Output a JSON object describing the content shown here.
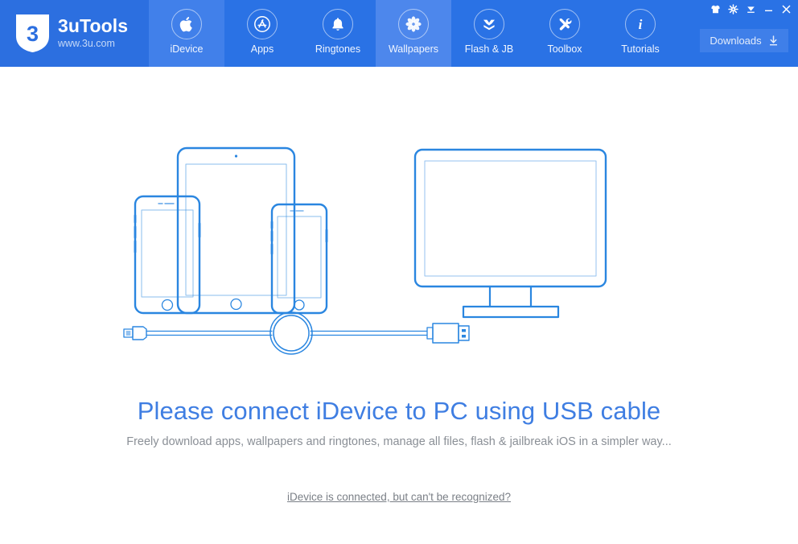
{
  "window": {
    "controls": [
      {
        "name": "skin-icon",
        "label": "Skin",
        "glyph": "tshirt"
      },
      {
        "name": "settings-icon",
        "label": "Settings",
        "glyph": "gear"
      },
      {
        "name": "minimize-to-tray-icon",
        "label": "Minimize to tray",
        "glyph": "tray"
      },
      {
        "name": "minimize-icon",
        "label": "Minimize",
        "glyph": "minimize"
      },
      {
        "name": "close-icon",
        "label": "Close",
        "glyph": "close"
      }
    ]
  },
  "brand": {
    "name": "3uTools",
    "url": "www.3u.com",
    "logo_icon": "shield-3-logo",
    "logo_digit": "3"
  },
  "nav": {
    "tabs": [
      {
        "label": "iDevice",
        "icon": "apple-icon",
        "state": "hover"
      },
      {
        "label": "Apps",
        "icon": "appstore-icon",
        "state": "normal"
      },
      {
        "label": "Ringtones",
        "icon": "bell-icon",
        "state": "normal"
      },
      {
        "label": "Wallpapers",
        "icon": "flower-icon",
        "state": "active"
      },
      {
        "label": "Flash & JB",
        "icon": "openbox-icon",
        "state": "normal"
      },
      {
        "label": "Toolbox",
        "icon": "tools-icon",
        "state": "normal"
      },
      {
        "label": "Tutorials",
        "icon": "info-icon",
        "state": "normal"
      }
    ]
  },
  "toolbar": {
    "downloads_label": "Downloads",
    "downloads_icon": "download-arrow-icon"
  },
  "main": {
    "illustration_name": "connect-devices-illustration",
    "headline": "Please connect iDevice to PC using USB cable",
    "subtitle": "Freely download apps, wallpapers and ringtones, manage all files, flash & jailbreak iOS in a simpler way...",
    "help_link": "iDevice is connected, but can't be recognized?"
  },
  "colors": {
    "header_blue": "#2a72e5",
    "logo_panel_blue": "#2c6fe0",
    "tab_hover_blue": "#4180ea",
    "tab_active_blue": "#4d87ec",
    "headline_blue": "#3f7ee2",
    "illustration_stroke": "#2a86e0",
    "subtitle_gray": "#8a8f96",
    "link_gray": "#7a7f86"
  }
}
